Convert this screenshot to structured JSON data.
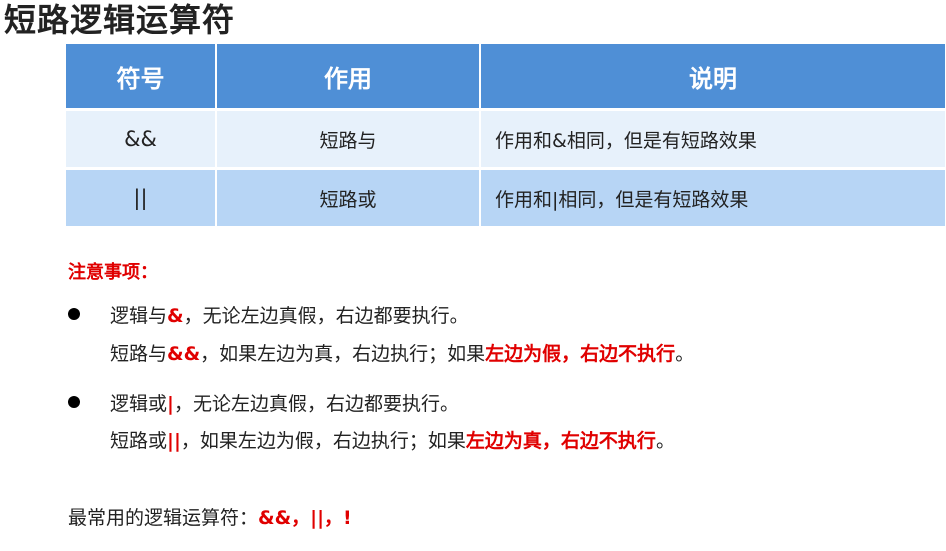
{
  "title": "短路逻辑运算符",
  "table": {
    "headers": [
      "符号",
      "作用",
      "说明"
    ],
    "rows": [
      {
        "symbol": "&&",
        "function": "短路与",
        "description": "作用和&相同，但是有短路效果"
      },
      {
        "symbol": "||",
        "function": "短路或",
        "description": "作用和|相同，但是有短路效果"
      }
    ]
  },
  "notes": {
    "heading": "注意事项：",
    "items": [
      {
        "line1": {
          "a": "逻辑与",
          "b": "&",
          "c": "，无论左边真假，右边都要执行。"
        },
        "line2": {
          "a": "短路与",
          "b": "&&",
          "c": "，如果左边为真，右边执行；如果",
          "d": "左边为假，右边不执行",
          "e": "。"
        }
      },
      {
        "line1": {
          "a": "逻辑或",
          "b": "|",
          "c": "，无论左边真假，右边都要执行。"
        },
        "line2": {
          "a": "短路或",
          "b": "||",
          "c": "，如果左边为假，右边执行；如果",
          "d": "左边为真，右边不执行",
          "e": "。"
        }
      }
    ]
  },
  "footer": {
    "label": "最常用的逻辑运算符：",
    "ops": "&&，||，!"
  }
}
